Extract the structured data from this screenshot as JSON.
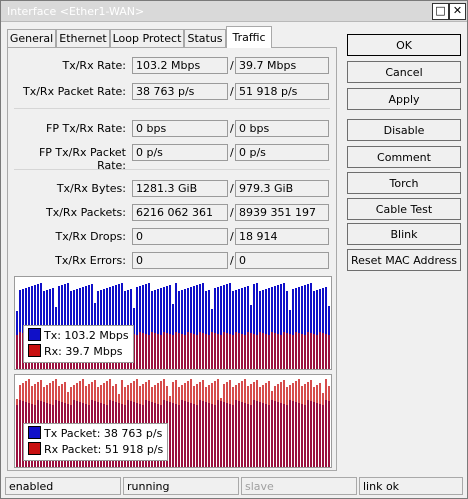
{
  "window": {
    "title": "Interface <Ether1-WAN>"
  },
  "tabs": [
    "General",
    "Ethernet",
    "Loop Protect",
    "Status",
    "Traffic"
  ],
  "rows": [
    {
      "label": "Tx/Rx Rate:",
      "tx": "103.2 Mbps",
      "rx": "39.7 Mbps"
    },
    {
      "label": "Tx/Rx Packet Rate:",
      "tx": "38 763 p/s",
      "rx": "51 918 p/s"
    },
    {
      "label": "FP Tx/Rx Rate:",
      "tx": "0 bps",
      "rx": "0 bps"
    },
    {
      "label": "FP Tx/Rx Packet Rate:",
      "tx": "0 p/s",
      "rx": "0 p/s"
    },
    {
      "label": "Tx/Rx Bytes:",
      "tx": "1281.3 GiB",
      "rx": "979.3 GiB"
    },
    {
      "label": "Tx/Rx Packets:",
      "tx": "6216 062 361",
      "rx": "8939 351 197"
    },
    {
      "label": "Tx/Rx Drops:",
      "tx": "0",
      "rx": "18 914"
    },
    {
      "label": "Tx/Rx Errors:",
      "tx": "0",
      "rx": "0"
    }
  ],
  "separator": "/",
  "graph_rate": {
    "legend": [
      "Tx:  103.2 Mbps",
      "Rx:  39.7 Mbps"
    ]
  },
  "graph_packets": {
    "legend": [
      "Tx Packet:  38 763 p/s",
      "Rx Packet:  51 918 p/s"
    ]
  },
  "colors": {
    "tx": "#1010c8",
    "rx": "#c81010"
  },
  "buttons": [
    "OK",
    "Cancel",
    "Apply",
    "Disable",
    "Comment",
    "Torch",
    "Cable Test",
    "Blink",
    "Reset MAC Address"
  ],
  "statusbar": [
    "enabled",
    "running",
    "slave",
    "link ok"
  ]
}
